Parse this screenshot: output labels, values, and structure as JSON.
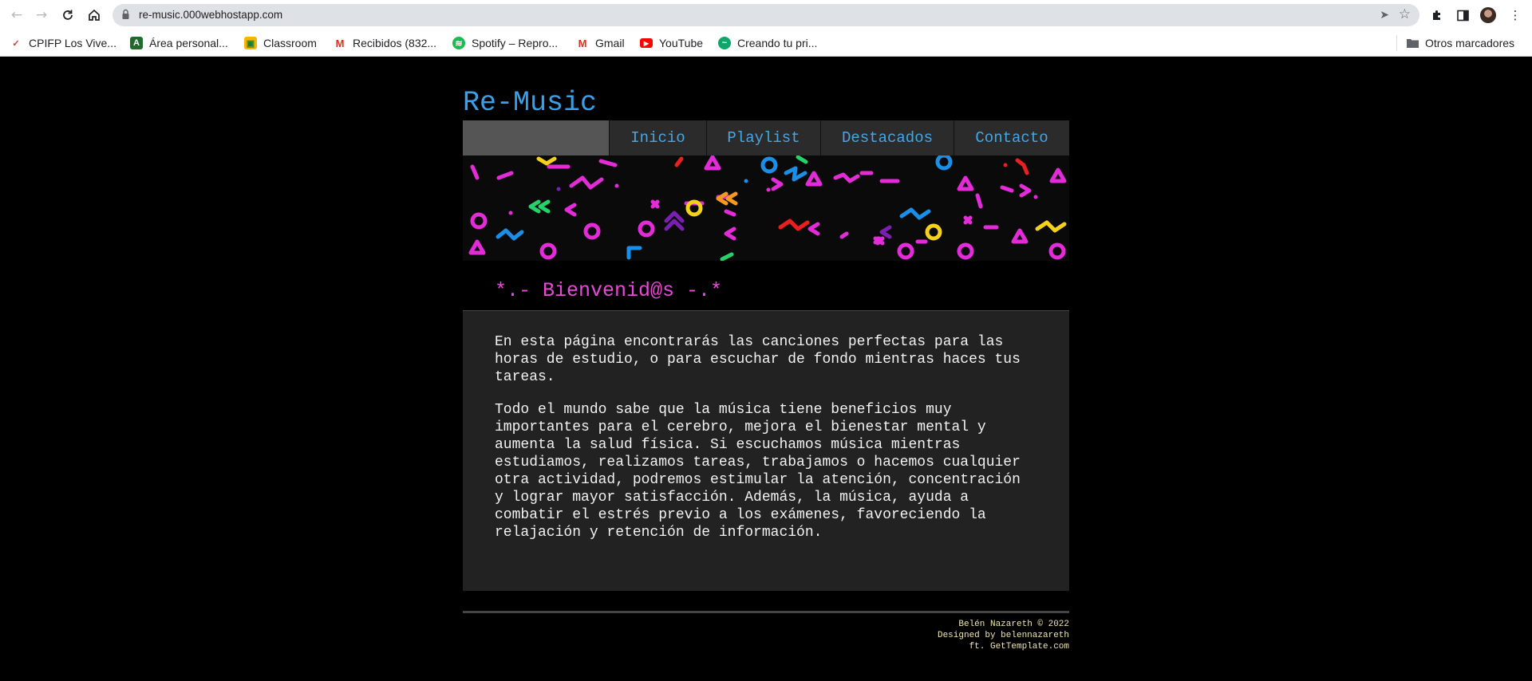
{
  "browser": {
    "url": "re-music.000webhostapp.com",
    "bookmarks": [
      {
        "label": "CPIFP Los Vive...",
        "icon": "cpifp-icon",
        "color": "#d8342a"
      },
      {
        "label": "Área personal...",
        "icon": "moodle-icon",
        "color": "#1e6b2c"
      },
      {
        "label": "Classroom",
        "icon": "classroom-icon",
        "color": "#f6b600"
      },
      {
        "label": "Recibidos (832...",
        "icon": "gmail-icon",
        "color": "#d93025"
      },
      {
        "label": "Spotify – Repro...",
        "icon": "spotify-icon",
        "color": "#1db954"
      },
      {
        "label": "Gmail",
        "icon": "gmail-icon",
        "color": "#d93025"
      },
      {
        "label": "YouTube",
        "icon": "youtube-icon",
        "color": "#ff0000"
      },
      {
        "label": "Creando tu pri...",
        "icon": "site-icon",
        "color": "#12a56b"
      }
    ],
    "other_bookmarks": "Otros marcadores"
  },
  "site": {
    "title": "Re-Music",
    "nav": [
      "Inicio",
      "Playlist",
      "Destacados",
      "Contacto"
    ],
    "welcome": "*.- Bienvenid@s -.*",
    "paragraphs": [
      "En esta página encontrarás las canciones perfectas para las horas de estudio, o para escuchar de fondo mientras haces tus tareas.",
      "Todo el mundo sabe que la música tiene beneficios muy importantes para el cerebro, mejora el bienestar mental y aumenta la salud física. Si escuchamos música mientras estudiamos, realizamos tareas, trabajamos o hacemos cualquier otra actividad, podremos estimular la atención, concentración y lograr mayor satisfacción. Además, la música, ayuda a combatir el estrés previo a los exámenes, favoreciendo la relajación y retención de información."
    ],
    "footer": [
      "Belén Nazareth © 2022",
      "Designed by belennazareth",
      "ft. GetTemplate.com"
    ]
  },
  "colors": {
    "title": "#3aa0e8",
    "nav_text": "#4aa5e0",
    "welcome": "#e84ad8",
    "footer_text": "#f0e6b0"
  }
}
